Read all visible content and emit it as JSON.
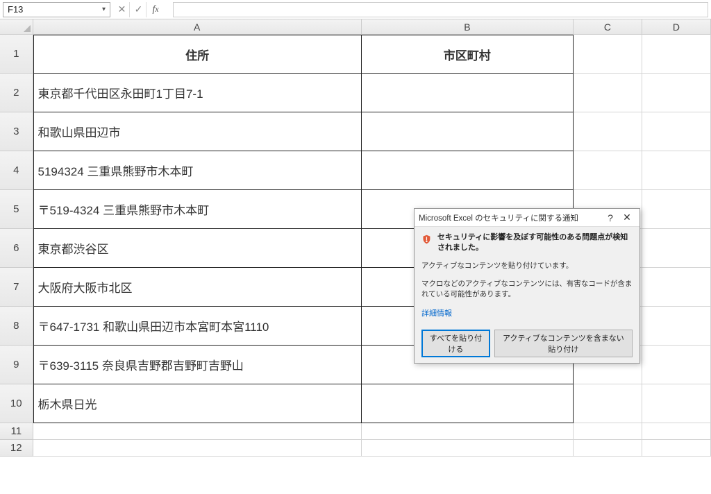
{
  "name_box": "F13",
  "formula_value": "",
  "columns": [
    "A",
    "B",
    "C",
    "D"
  ],
  "headers": {
    "A": "住所",
    "B": "市区町村"
  },
  "rows": [
    {
      "n": 2,
      "A": "東京都千代田区永田町1丁目7-1",
      "B": ""
    },
    {
      "n": 3,
      "A": "和歌山県田辺市",
      "B": ""
    },
    {
      "n": 4,
      "A": "5194324 三重県熊野市木本町",
      "B": ""
    },
    {
      "n": 5,
      "A": "〒519-4324 三重県熊野市木本町",
      "B": ""
    },
    {
      "n": 6,
      "A": "東京都渋谷区",
      "B": ""
    },
    {
      "n": 7,
      "A": "大阪府大阪市北区",
      "B": ""
    },
    {
      "n": 8,
      "A": "〒647-1731 和歌山県田辺市本宮町本宮1110",
      "B": ""
    },
    {
      "n": 9,
      "A": "〒639-3115 奈良県吉野郡吉野町吉野山",
      "B": ""
    },
    {
      "n": 10,
      "A": "栃木県日光",
      "B": ""
    }
  ],
  "dialog": {
    "title": "Microsoft Excel のセキュリティに関する通知",
    "warn": "セキュリティに影響を及ぼす可能性のある問題点が検知されました。",
    "line1": "アクティブなコンテンツを貼り付けています。",
    "line2": "マクロなどのアクティブなコンテンツには、有害なコードが含まれている可能性があります。",
    "link": "詳細情報",
    "btn_primary": "すべてを貼り付ける",
    "btn_secondary": "アクティブなコンテンツを含まない貼り付け"
  }
}
